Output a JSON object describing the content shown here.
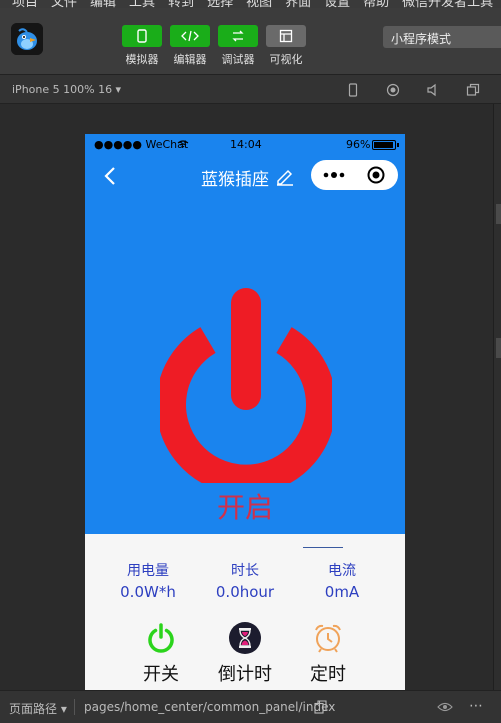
{
  "menubar": {
    "items": [
      "项目",
      "文件",
      "编辑",
      "工具",
      "转到",
      "选择",
      "视图",
      "界面",
      "设置",
      "帮助",
      "微信开发者工具"
    ]
  },
  "toolbar": {
    "tools": [
      {
        "label": "模拟器",
        "icon": "phone-icon"
      },
      {
        "label": "编辑器",
        "icon": "code-icon"
      },
      {
        "label": "调试器",
        "icon": "debug-icon"
      },
      {
        "label": "可视化",
        "icon": "layout-icon"
      }
    ],
    "mode": "小程序模式"
  },
  "devicebar": {
    "device": "iPhone 5 100% 16 ▾"
  },
  "phone": {
    "status": {
      "carrier": "●●●●● WeChat",
      "time": "14:04",
      "battery": "96%"
    },
    "nav": {
      "title": "蓝猴插座"
    },
    "hero": {
      "state": "开启",
      "power_color": "#ee1c25",
      "bg": "#1a84ee"
    },
    "stats": [
      {
        "label": "用电量",
        "value": "0.0W*h"
      },
      {
        "label": "时长",
        "value": "0.0hour"
      },
      {
        "label": "电流",
        "value": "0mA"
      }
    ],
    "actions": [
      {
        "label": "开关",
        "icon": "power-icon"
      },
      {
        "label": "倒计时",
        "icon": "hourglass-icon"
      },
      {
        "label": "定时",
        "icon": "alarm-clock-icon"
      }
    ]
  },
  "bottombar": {
    "path_label": "页面路径 ▾",
    "path": "pages/home_center/common_panel/index",
    "more": "⋯"
  }
}
